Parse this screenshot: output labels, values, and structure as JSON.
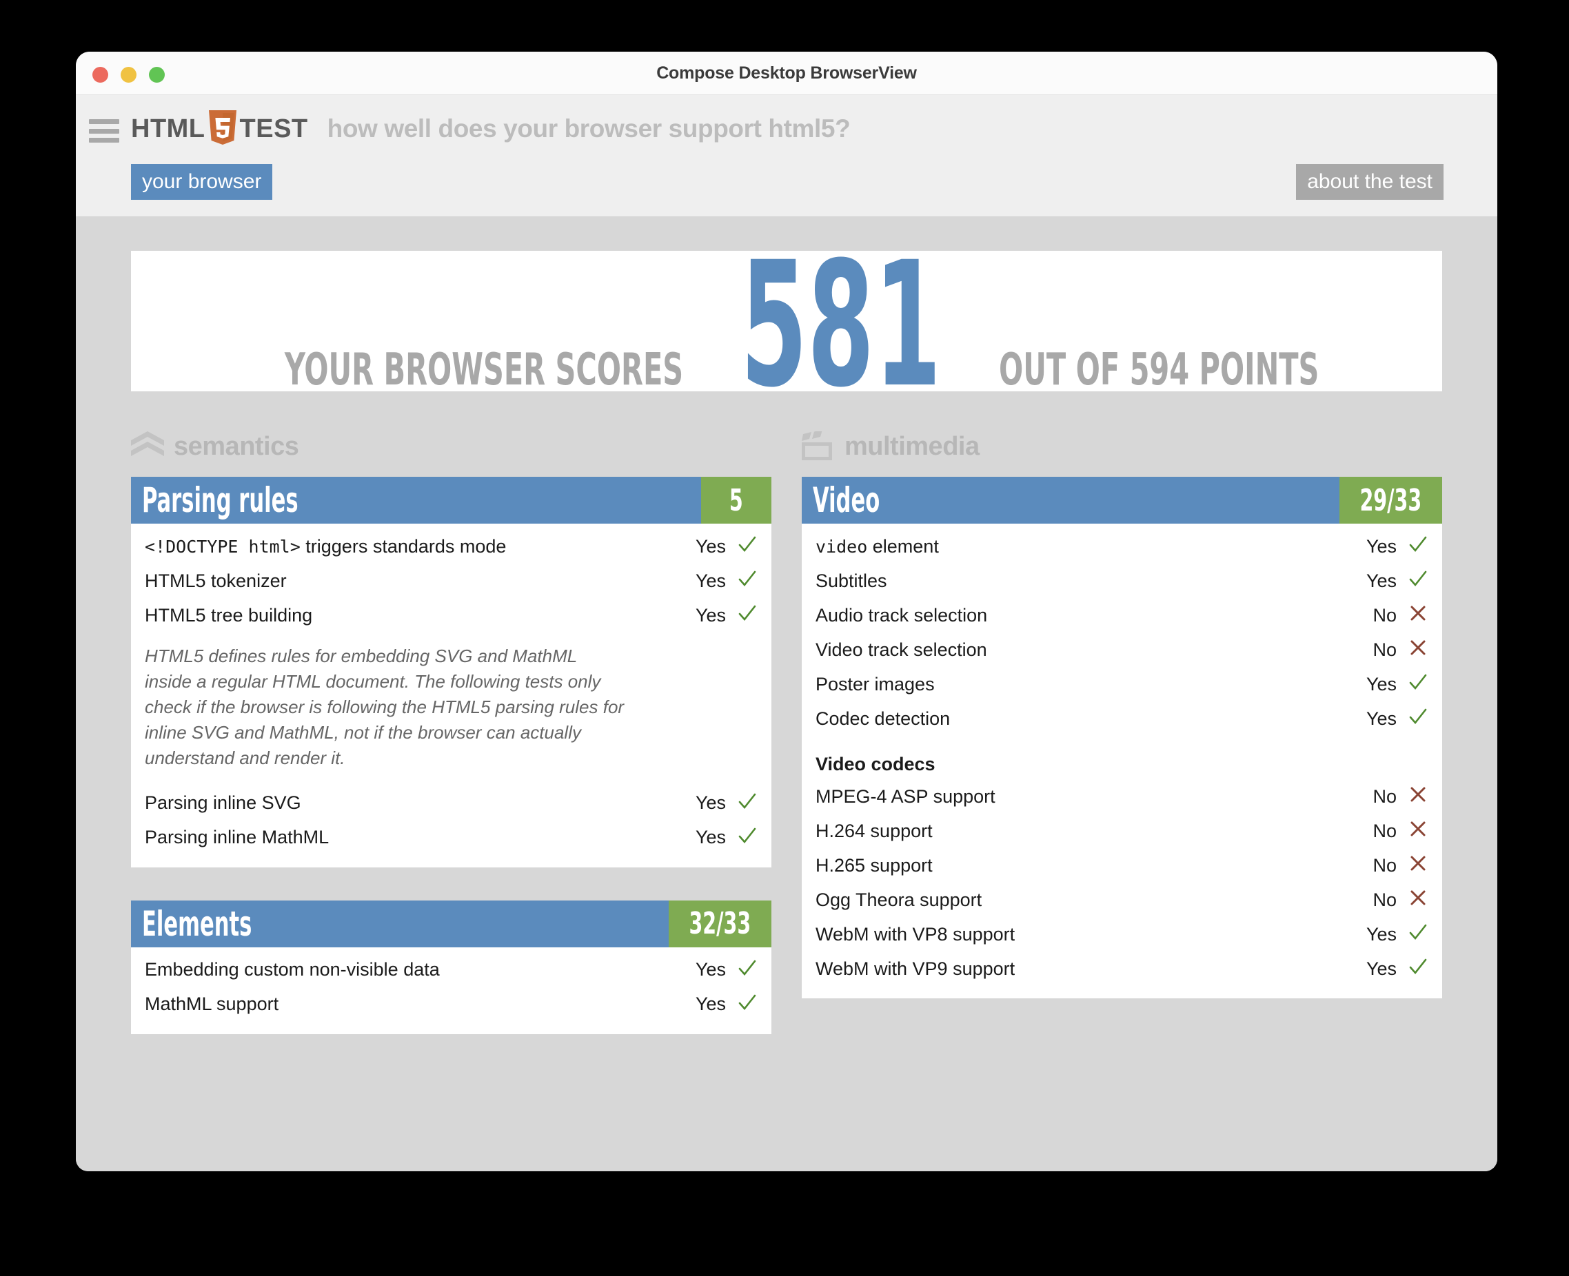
{
  "window": {
    "title": "Compose Desktop BrowserView",
    "traffic_lights": [
      "close",
      "minimize",
      "zoom"
    ]
  },
  "header": {
    "menu_icon": "hamburger-icon",
    "logo": {
      "left": "HTML",
      "shield": "5",
      "right": "TEST"
    },
    "tagline": "how well does your browser support html5?",
    "tabs": [
      {
        "label": "your browser",
        "active": true
      },
      {
        "label": "about the test",
        "active": false
      }
    ]
  },
  "score": {
    "prefix": "YOUR BROWSER SCORES",
    "value": "581",
    "suffix": "OUT OF 594 POINTS",
    "points_earned": 581,
    "points_total": 594
  },
  "colors": {
    "accent_blue": "#5b8bbd",
    "score_green": "#7fab52",
    "yes_green": "#4f8a2e",
    "no_red": "#8a4434",
    "muted_gray": "#a8a8a8",
    "page_bg": "#d7d7d7"
  },
  "columns": [
    {
      "category": {
        "label": "semantics",
        "icon": "chevrons-icon"
      },
      "cards": [
        {
          "title": "Parsing rules",
          "score": "5",
          "items": [
            {
              "type": "test",
              "name_code": "<!DOCTYPE html>",
              "name": " triggers standards mode",
              "result": "Yes",
              "mark": "yes"
            },
            {
              "type": "test",
              "name": "HTML5 tokenizer",
              "result": "Yes",
              "mark": "yes"
            },
            {
              "type": "test",
              "name": "HTML5 tree building",
              "result": "Yes",
              "mark": "yes"
            },
            {
              "type": "note",
              "text": "HTML5 defines rules for embedding SVG and MathML inside a regular HTML document. The following tests only check if the browser is following the HTML5 parsing rules for inline SVG and MathML, not if the browser can actually understand and render it."
            },
            {
              "type": "test",
              "name": "Parsing inline SVG",
              "result": "Yes",
              "mark": "yes"
            },
            {
              "type": "test",
              "name": "Parsing inline MathML",
              "result": "Yes",
              "mark": "yes"
            }
          ]
        },
        {
          "title": "Elements",
          "score": "32/33",
          "items": [
            {
              "type": "test",
              "name": "Embedding custom non-visible data",
              "result": "Yes",
              "mark": "yes"
            },
            {
              "type": "test",
              "name": "MathML support",
              "result": "Yes",
              "mark": "yes"
            }
          ]
        }
      ]
    },
    {
      "category": {
        "label": "multimedia",
        "icon": "clapperboard-icon"
      },
      "cards": [
        {
          "title": "Video",
          "score": "29/33",
          "items": [
            {
              "type": "test",
              "name_code": "video",
              "name": " element",
              "result": "Yes",
              "mark": "yes"
            },
            {
              "type": "test",
              "name": "Subtitles",
              "result": "Yes",
              "mark": "yes"
            },
            {
              "type": "test",
              "name": "Audio track selection",
              "result": "No",
              "mark": "no"
            },
            {
              "type": "test",
              "name": "Video track selection",
              "result": "No",
              "mark": "no"
            },
            {
              "type": "test",
              "name": "Poster images",
              "result": "Yes",
              "mark": "yes"
            },
            {
              "type": "test",
              "name": "Codec detection",
              "result": "Yes",
              "mark": "yes"
            },
            {
              "type": "subhead",
              "text": "Video codecs"
            },
            {
              "type": "test",
              "name": "MPEG-4 ASP support",
              "result": "No",
              "mark": "no"
            },
            {
              "type": "test",
              "name": "H.264 support",
              "result": "No",
              "mark": "no"
            },
            {
              "type": "test",
              "name": "H.265 support",
              "result": "No",
              "mark": "no"
            },
            {
              "type": "test",
              "name": "Ogg Theora support",
              "result": "No",
              "mark": "no"
            },
            {
              "type": "test",
              "name": "WebM with VP8 support",
              "result": "Yes",
              "mark": "yes"
            },
            {
              "type": "test",
              "name": "WebM with VP9 support",
              "result": "Yes",
              "mark": "yes"
            }
          ]
        }
      ]
    }
  ]
}
